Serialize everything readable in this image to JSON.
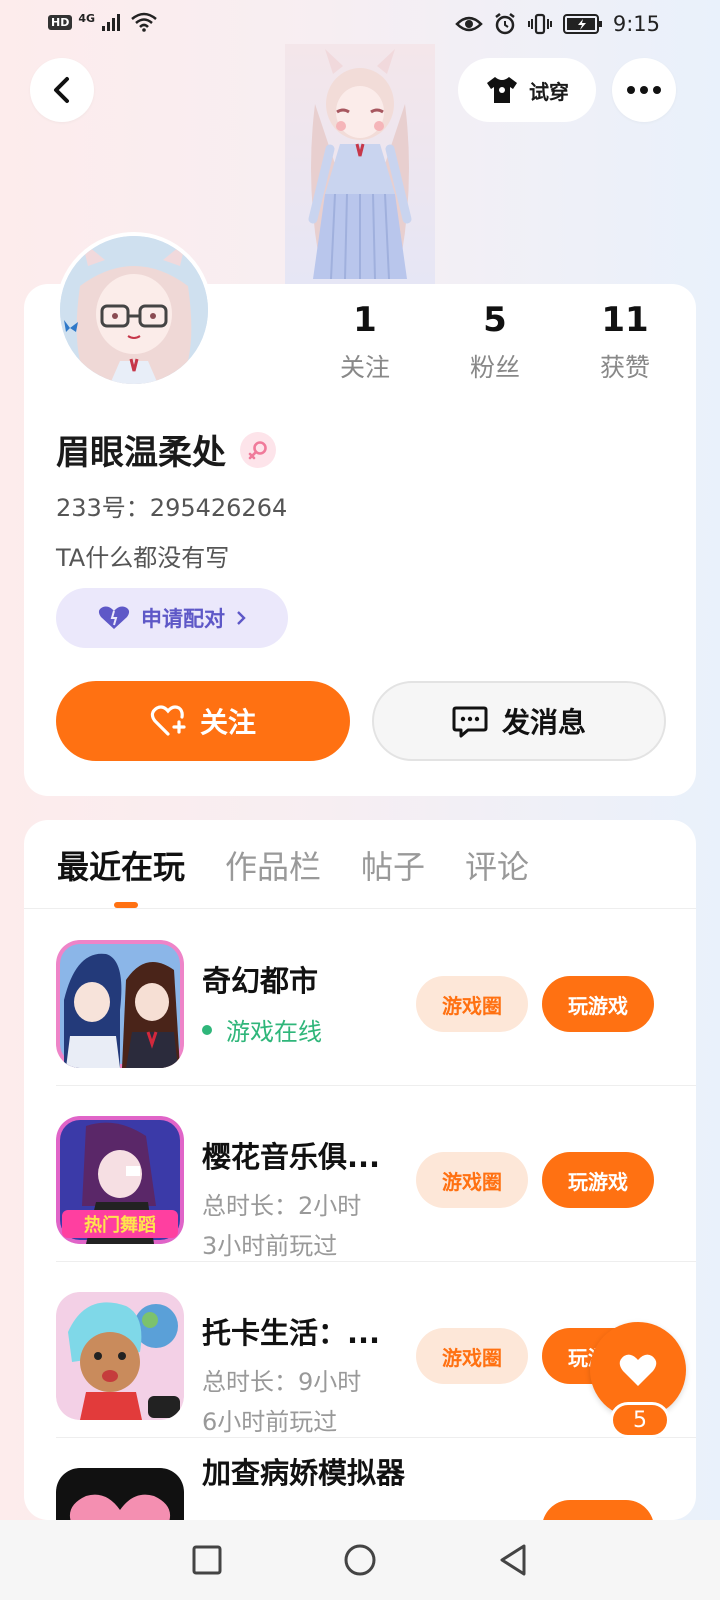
{
  "status_bar": {
    "network": "HD",
    "signal": "4G",
    "time": "9:15"
  },
  "header": {
    "back_icon": "chevron-left-icon",
    "tryon_label": "试穿",
    "tryon_icon": "tshirt-icon",
    "more_icon": "more-dots-icon"
  },
  "profile": {
    "stats": [
      {
        "value": "1",
        "label": "关注"
      },
      {
        "value": "5",
        "label": "粉丝"
      },
      {
        "value": "11",
        "label": "获赞"
      }
    ],
    "name": "眉眼温柔处",
    "gender_icon": "female-icon",
    "uid": "233号：295426264",
    "bio": "TA什么都没有写",
    "pair_label": "申请配对",
    "follow_label": "关注",
    "message_label": "发消息"
  },
  "tabs": [
    "最近在玩",
    "作品栏",
    "帖子",
    "评论"
  ],
  "games": [
    {
      "title": "奇幻都市",
      "line1": "游戏在线",
      "online": true,
      "circle": "游戏圈",
      "play": "玩游戏"
    },
    {
      "title": "樱花音乐俱...",
      "line1": "总时长：2小时",
      "line2": "3小时前玩过",
      "circle": "游戏圈",
      "play": "玩游戏",
      "icon_text": "热门舞蹈"
    },
    {
      "title": "托卡生活：...",
      "line1": "总时长：9小时",
      "line2": "6小时前玩过",
      "circle": "游戏圈",
      "play": "玩游戏"
    },
    {
      "title": "加查病娇模拟器"
    }
  ],
  "like_fab": {
    "count": "5"
  },
  "colors": {
    "accent": "#ff7112",
    "pair_purple": "#5e58c7",
    "online_green": "#2fb67a"
  }
}
